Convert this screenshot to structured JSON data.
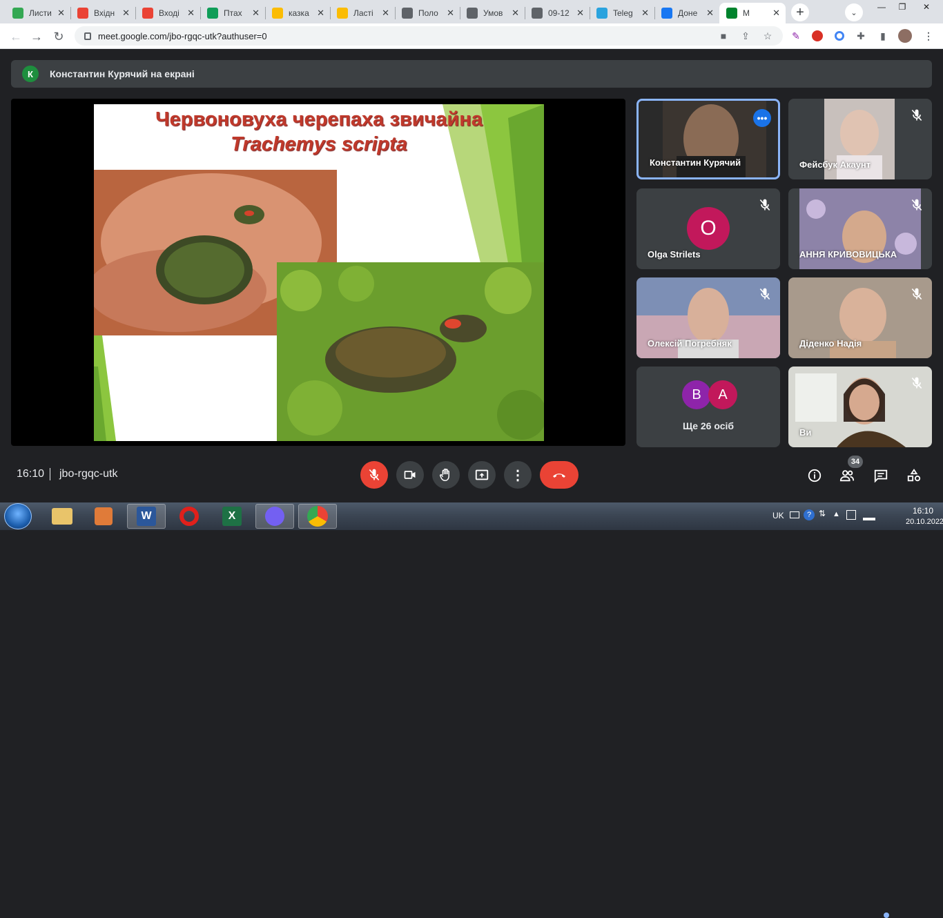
{
  "browser": {
    "tabs": [
      {
        "title": "Листи",
        "icon": "docs-icon",
        "color": "#34a853"
      },
      {
        "title": "Вхідн",
        "icon": "gmail-icon",
        "color": "#ea4335"
      },
      {
        "title": "Вході",
        "icon": "gmail-icon",
        "color": "#ea4335"
      },
      {
        "title": "Птах",
        "icon": "sheets-icon",
        "color": "#0f9d58"
      },
      {
        "title": "казка",
        "icon": "drive-icon",
        "color": "#fbbc04"
      },
      {
        "title": "Ласті",
        "icon": "drive-icon",
        "color": "#fbbc04"
      },
      {
        "title": "Поло",
        "icon": "classroom-icon",
        "color": "#5f6368"
      },
      {
        "title": "Умов",
        "icon": "classroom-icon",
        "color": "#5f6368"
      },
      {
        "title": "09-12",
        "icon": "classroom-icon",
        "color": "#5f6368"
      },
      {
        "title": "Teleg",
        "icon": "telegram-icon",
        "color": "#2aa3de"
      },
      {
        "title": "Доне",
        "icon": "facebook-icon",
        "color": "#1877f2"
      },
      {
        "title": "M",
        "icon": "meet-icon",
        "color": "#00832d"
      }
    ],
    "url": "meet.google.com/jbo-rgqc-utk?authuser=0"
  },
  "banner": {
    "initial": "К",
    "text": "Константин Курячий на екрані"
  },
  "slide": {
    "title": "Червоновуха черепаха звичайна",
    "subtitle": "Trachemys scripta"
  },
  "participants": [
    {
      "name": "Константин Курячий",
      "muted": false,
      "active": true
    },
    {
      "name": "Фейсбук Акаунт",
      "muted": true
    },
    {
      "name": "Olga Strilets",
      "muted": true,
      "initial": "O",
      "avatar_color": "#c2185b"
    },
    {
      "name": "АННЯ КРИВОВИЦЬКА",
      "muted": true
    },
    {
      "name": "Олексій Погребняк",
      "muted": true
    },
    {
      "name": "Діденко Надія",
      "muted": true
    },
    {
      "name": "Ще 26 осіб",
      "initials": [
        "B",
        "A"
      ],
      "avatar_colors": [
        "#8e24aa",
        "#c2185b"
      ]
    },
    {
      "name": "Ви",
      "muted": true
    }
  ],
  "bottom": {
    "time": "16:10",
    "meeting_code": "jbo-rgqc-utk",
    "people_count": "34"
  },
  "taskbar": {
    "lang": "UK",
    "time": "16:10",
    "date": "20.10.2022"
  }
}
